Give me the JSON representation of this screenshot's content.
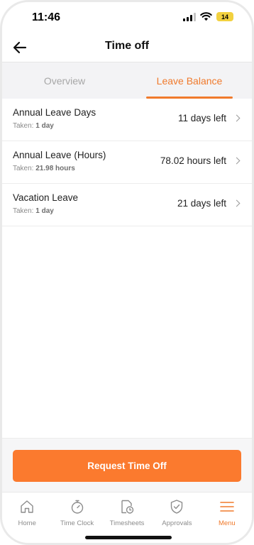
{
  "status_bar": {
    "time": "11:46",
    "battery": "14"
  },
  "header": {
    "title": "Time off",
    "back_icon": "arrow-left-icon"
  },
  "tabs": [
    {
      "label": "Overview",
      "active": false
    },
    {
      "label": "Leave Balance",
      "active": true
    }
  ],
  "leave_items": [
    {
      "name": "Annual Leave Days",
      "taken_label": "Taken:",
      "taken_value": "1 day",
      "balance": "11 days left"
    },
    {
      "name": "Annual Leave (Hours)",
      "taken_label": "Taken:",
      "taken_value": "21.98 hours",
      "balance": "78.02 hours left"
    },
    {
      "name": "Vacation Leave",
      "taken_label": "Taken:",
      "taken_value": "1 day",
      "balance": "21 days left"
    }
  ],
  "action": {
    "request_label": "Request Time Off"
  },
  "tabbar": [
    {
      "label": "Home",
      "icon": "home-icon",
      "active": false
    },
    {
      "label": "Time Clock",
      "icon": "stopwatch-icon",
      "active": false
    },
    {
      "label": "Timesheets",
      "icon": "timesheet-icon",
      "active": false
    },
    {
      "label": "Approvals",
      "icon": "shield-check-icon",
      "active": false
    },
    {
      "label": "Menu",
      "icon": "menu-icon",
      "active": true
    }
  ],
  "colors": {
    "accent": "#f07a2c",
    "button": "#fb7a2e"
  }
}
